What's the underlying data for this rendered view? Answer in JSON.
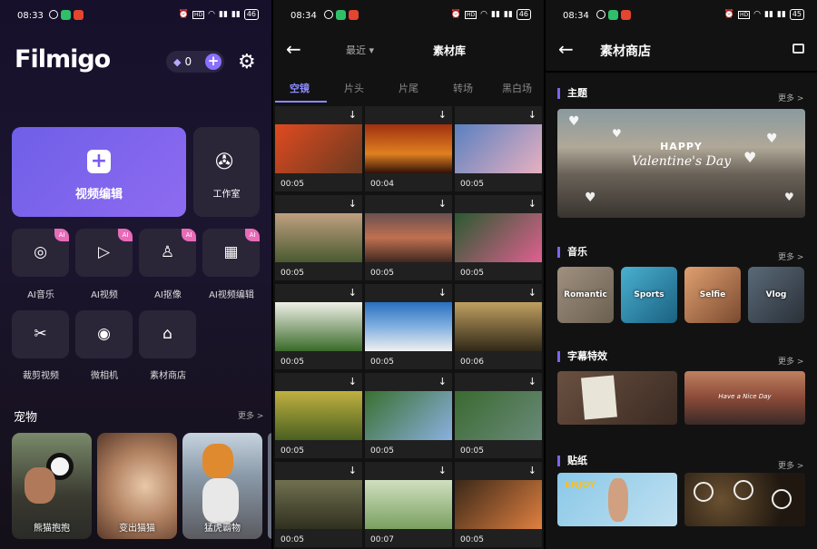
{
  "screens": [
    {
      "status": {
        "time": "08:33",
        "battery": "46"
      },
      "logo": "Filmigo",
      "gems": {
        "count": "0"
      },
      "main_action": "视频编辑",
      "studio": "工作室",
      "tools": [
        "AI音乐",
        "AI视频",
        "AI抠像",
        "AI视频编辑",
        "裁剪视频",
        "微相机",
        "素材商店"
      ],
      "section": {
        "title": "宠物",
        "more": "更多 >"
      },
      "pets": [
        "熊猫抱抱",
        "变出猫猫",
        "猛虎霸物"
      ]
    },
    {
      "status": {
        "time": "08:34",
        "battery": "46"
      },
      "recent": "最近 ▾",
      "title": "素材库",
      "tabs": [
        "空镜",
        "片头",
        "片尾",
        "转场",
        "黑白场"
      ],
      "durations": [
        "00:05",
        "00:04",
        "00:05",
        "00:05",
        "00:05",
        "00:05",
        "00:05",
        "00:05",
        "00:06",
        "00:05",
        "00:05",
        "00:05",
        "00:05",
        "00:07",
        "00:05"
      ]
    },
    {
      "status": {
        "time": "08:34",
        "battery": "45"
      },
      "title": "素材商店",
      "sections": [
        {
          "title": "主题",
          "more": "更多 >"
        },
        {
          "title": "音乐",
          "more": "更多 >"
        },
        {
          "title": "字幕特效",
          "more": "更多 >"
        },
        {
          "title": "贴纸",
          "more": "更多 >"
        }
      ],
      "theme_banner": {
        "line1": "HAPPY",
        "line2": "Valentine's Day"
      },
      "music": [
        "Romantic",
        "Sports",
        "Selfie",
        "Vlog"
      ],
      "subtitle_card": "Have a Nice Day",
      "sticker_card": "ENJOY"
    }
  ],
  "colors": {
    "accent": "#7c63f0",
    "tab_active": "#8b8bff"
  }
}
